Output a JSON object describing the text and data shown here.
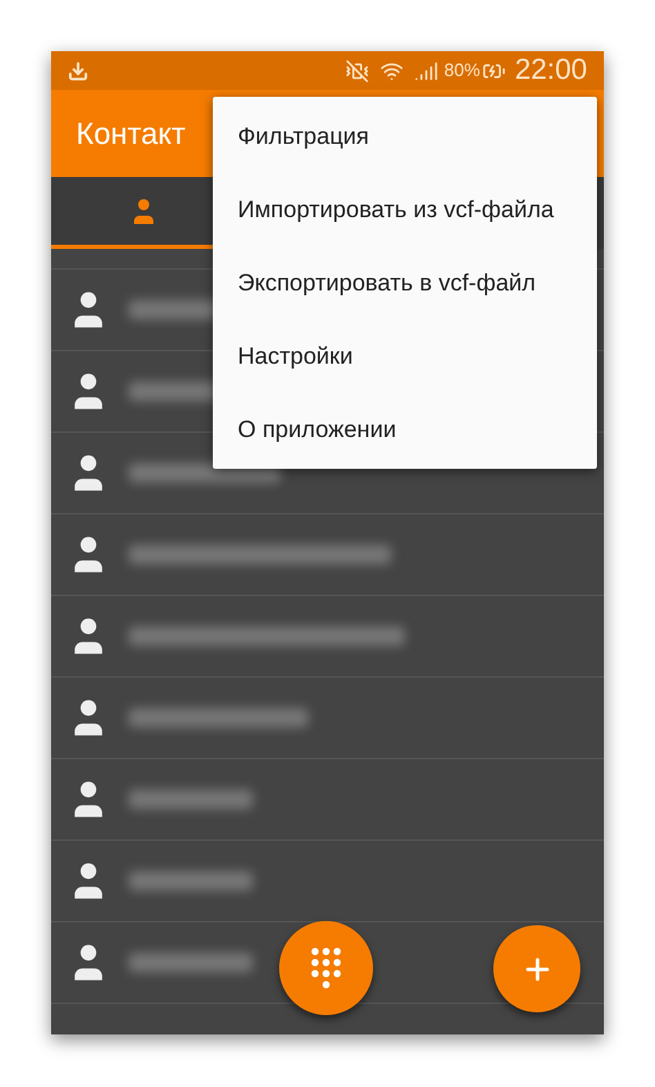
{
  "status_bar": {
    "battery": "80%",
    "time": "22:00"
  },
  "app_bar": {
    "title": "Контакт"
  },
  "tabs": [
    {
      "kind": "contacts",
      "selected": true
    }
  ],
  "contacts": [
    {
      "kind": "blurred"
    },
    {
      "kind": "blurred"
    },
    {
      "kind": "blurred"
    },
    {
      "kind": "blurred"
    },
    {
      "kind": "blurred"
    },
    {
      "kind": "blurred"
    },
    {
      "kind": "blurred"
    },
    {
      "kind": "blurred"
    },
    {
      "kind": "blurred"
    }
  ],
  "menu": {
    "items": [
      "Фильтрация",
      "Импортировать из vcf-файла",
      "Экспортировать в vcf-файл",
      "Настройки",
      "О приложении"
    ]
  },
  "fabs": [
    {
      "kind": "dialpad"
    },
    {
      "kind": "add"
    }
  ]
}
